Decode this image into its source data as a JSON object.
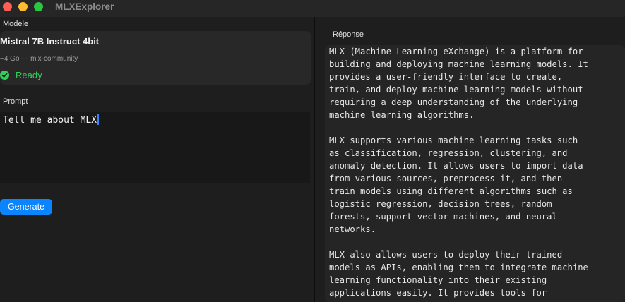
{
  "window": {
    "title": "MLXExplorer"
  },
  "model_section": {
    "label": "Modele",
    "model_name": "Mistral 7B Instruct 4bit",
    "model_meta": "~4 Go — mlx-community",
    "status": "Ready",
    "status_icon": "checkmark-circle-icon",
    "status_color": "#30d158"
  },
  "prompt_section": {
    "label": "Prompt",
    "value": "Tell me about MLX"
  },
  "generate": {
    "label": "Generate",
    "color": "#0a84ff"
  },
  "response_section": {
    "label": "Réponse",
    "text": "MLX (Machine Learning eXchange) is a platform for\nbuilding and deploying machine learning models. It\nprovides a user-friendly interface to create,\ntrain, and deploy machine learning models without\nrequiring a deep understanding of the underlying\nmachine learning algorithms.\n\nMLX supports various machine learning tasks such\nas classification, regression, clustering, and\nanomaly detection. It allows users to import data\nfrom various sources, preprocess it, and then\ntrain models using different algorithms such as\nlogistic regression, decision trees, random\nforests, support vector machines, and neural\nnetworks.\n\nMLX also allows users to deploy their trained\nmodels as APIs, enabling them to integrate machine\nlearning functionality into their existing\napplications easily. It provides tools for"
  }
}
